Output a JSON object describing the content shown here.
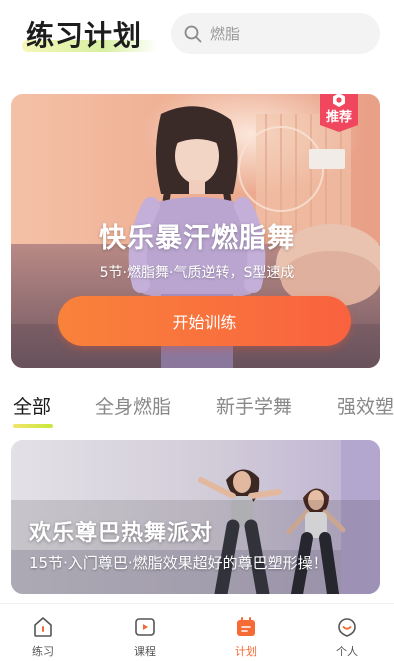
{
  "header": {
    "title": "练习计划",
    "search_placeholder": "燃脂"
  },
  "hero": {
    "badge": "推荐",
    "title": "快乐暴汗燃脂舞",
    "subtitle": "5节·燃脂舞·气质逆转，S型速成",
    "button": "开始训练"
  },
  "tabs": [
    {
      "label": "全部",
      "active": true
    },
    {
      "label": "全身燃脂",
      "active": false
    },
    {
      "label": "新手学舞",
      "active": false
    },
    {
      "label": "强效塑",
      "active": false
    }
  ],
  "course": {
    "title": "欢乐尊巴热舞派对",
    "subtitle": "15节·入门尊巴·燃脂效果超好的尊巴塑形操！"
  },
  "nav": [
    {
      "label": "练习",
      "icon": "home-icon",
      "active": false
    },
    {
      "label": "课程",
      "icon": "play-icon",
      "active": false
    },
    {
      "label": "计划",
      "icon": "calendar-icon",
      "active": true
    },
    {
      "label": "个人",
      "icon": "profile-icon",
      "active": false
    }
  ],
  "colors": {
    "accent": "#f66a35",
    "button_gradient_start": "#f9823a",
    "button_gradient_end": "#f9623f",
    "badge": "#f0475f",
    "tab_indicator": "#c6ea3a"
  }
}
